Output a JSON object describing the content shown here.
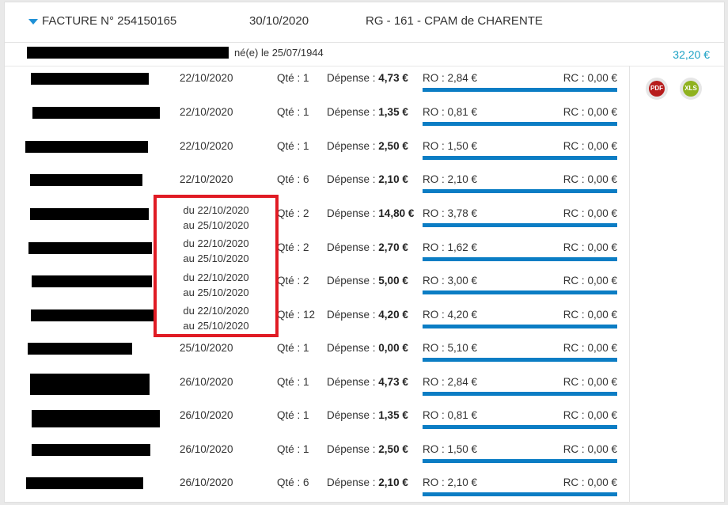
{
  "invoice": {
    "title": "FACTURE N° 254150165",
    "date": "30/10/2020",
    "org": "RG - 161 - CPAM de CHARENTE",
    "birth": "né(e) le 25/07/1944",
    "total": "32,20 €"
  },
  "labels": {
    "qty_prefix": "Qté : ",
    "dep_prefix": "Dépense : ",
    "ro_prefix": "RO : ",
    "rc_prefix": "RC : "
  },
  "icons": {
    "pdf": "PDF",
    "xls": "XLS"
  },
  "rows": [
    {
      "date": "22/10/2020",
      "qty": "1",
      "dep": "4,73 €",
      "ro": "2,84 €",
      "rc": "0,00 €"
    },
    {
      "date": "22/10/2020",
      "qty": "1",
      "dep": "1,35 €",
      "ro": "0,81 €",
      "rc": "0,00 €"
    },
    {
      "date": "22/10/2020",
      "qty": "1",
      "dep": "2,50 €",
      "ro": "1,50 €",
      "rc": "0,00 €"
    },
    {
      "date": "22/10/2020",
      "qty": "6",
      "dep": "2,10 €",
      "ro": "2,10 €",
      "rc": "0,00 €"
    },
    {
      "date": "",
      "qty": "2",
      "dep": "14,80 €",
      "ro": "3,78 €",
      "rc": "0,00 €"
    },
    {
      "date": "",
      "qty": "2",
      "dep": "2,70 €",
      "ro": "1,62 €",
      "rc": "0,00 €"
    },
    {
      "date": "",
      "qty": "2",
      "dep": "5,00 €",
      "ro": "3,00 €",
      "rc": "0,00 €"
    },
    {
      "date": "",
      "qty": "12",
      "dep": "4,20 €",
      "ro": "4,20 €",
      "rc": "0,00 €"
    },
    {
      "date": "25/10/2020",
      "qty": "1",
      "dep": "0,00 €",
      "ro": "5,10 €",
      "rc": "0,00 €"
    },
    {
      "date": "26/10/2020",
      "qty": "1",
      "dep": "4,73 €",
      "ro": "2,84 €",
      "rc": "0,00 €"
    },
    {
      "date": "26/10/2020",
      "qty": "1",
      "dep": "1,35 €",
      "ro": "0,81 €",
      "rc": "0,00 €"
    },
    {
      "date": "26/10/2020",
      "qty": "1",
      "dep": "2,50 €",
      "ro": "1,50 €",
      "rc": "0,00 €"
    },
    {
      "date": "26/10/2020",
      "qty": "6",
      "dep": "2,10 €",
      "ro": "2,10 €",
      "rc": "0,00 €"
    }
  ],
  "ranges": [
    {
      "from": "du 22/10/2020",
      "to": "au 25/10/2020"
    },
    {
      "from": "du 22/10/2020",
      "to": "au 25/10/2020"
    },
    {
      "from": "du 22/10/2020",
      "to": "au 25/10/2020"
    },
    {
      "from": "du 22/10/2020",
      "to": "au 25/10/2020"
    }
  ]
}
